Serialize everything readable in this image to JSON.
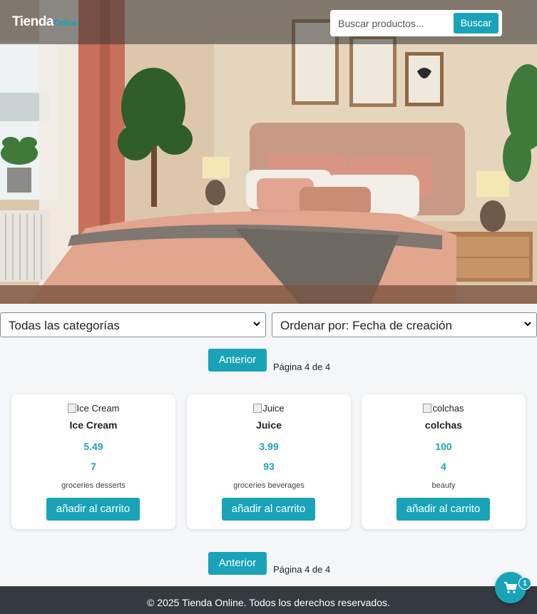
{
  "header": {
    "logo_main": "Tienda",
    "logo_sub": "Online",
    "search_placeholder": "Buscar productos...",
    "search_button": "Buscar"
  },
  "filters": {
    "category_selected": "Todas las categorías",
    "sort_selected": "Ordenar por: Fecha de creación"
  },
  "pagination": {
    "prev_label": "Anterior",
    "page_text": "Página 4 de 4"
  },
  "products": [
    {
      "image_alt": "Ice Cream",
      "name": "Ice Cream",
      "price": "5.49",
      "stock": "7",
      "categories": "groceries desserts",
      "add_label": "añadir al carrito"
    },
    {
      "image_alt": "Juice",
      "name": "Juice",
      "price": "3.99",
      "stock": "93",
      "categories": "groceries beverages",
      "add_label": "añadir al carrito"
    },
    {
      "image_alt": "colchas",
      "name": "colchas",
      "price": "100",
      "stock": "4",
      "categories": "beauty",
      "add_label": "añadir al carrito"
    }
  ],
  "footer": {
    "text": "© 2025 Tienda Online. Todos los derechos reservados."
  },
  "cart": {
    "count": "1",
    "icon": "cart-icon"
  },
  "colors": {
    "accent": "#1aa3b8",
    "footer_bg": "#343a40"
  }
}
